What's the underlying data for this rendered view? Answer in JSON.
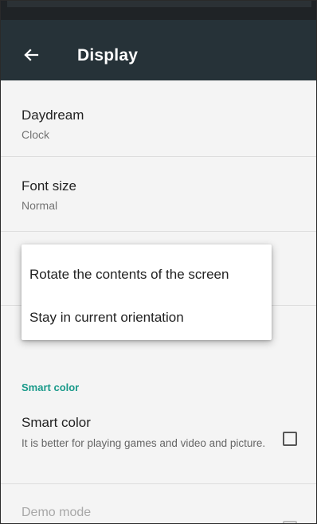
{
  "app_bar": {
    "title": "Display",
    "back_icon": "arrow-left-icon"
  },
  "colors": {
    "app_bar": "#263238",
    "accent": "#1a9a8a",
    "background": "#f4f4f4"
  },
  "settings": {
    "daydream": {
      "title": "Daydream",
      "value": "Clock"
    },
    "font_size": {
      "title": "Font size",
      "value": "Normal"
    }
  },
  "rotation_popup": {
    "options": [
      "Rotate the contents of the screen",
      "Stay in current orientation"
    ]
  },
  "smart_color_section": {
    "header": "Smart color",
    "item": {
      "title": "Smart color",
      "summary": "It is better for playing games and video and picture.",
      "checked": false
    }
  },
  "demo_mode": {
    "title": "Demo mode",
    "checked": false
  }
}
